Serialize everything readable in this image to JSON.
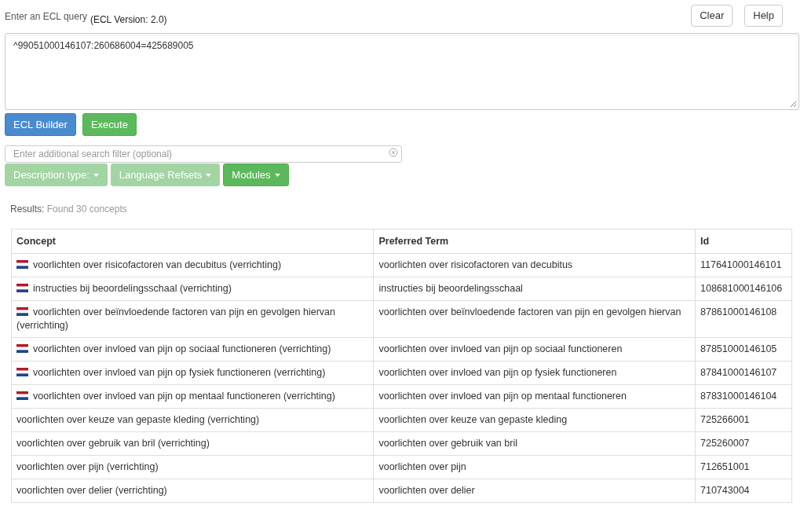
{
  "query_label": "Enter an ECL query",
  "version_label": "(ECL Version: 2.0)",
  "header_buttons": [
    "Clear",
    "Help"
  ],
  "query": {
    "value": "^99051000146107:260686004=425689005"
  },
  "action_buttons": [
    {
      "label": "ECL Builder",
      "kind": "primary"
    },
    {
      "label": "Execute",
      "kind": "success"
    }
  ],
  "filter": {
    "placeholder": "Enter additional search filter (optional)"
  },
  "dropdowns": [
    {
      "label": "Description type:",
      "disabled": true
    },
    {
      "label": "Language Refsets",
      "disabled": true
    },
    {
      "label": "Modules",
      "disabled": false
    }
  ],
  "results": {
    "label": "Results:",
    "value": "Found 30 concepts"
  },
  "table": {
    "columns": [
      "Concept",
      "Preferred Term",
      "Id"
    ],
    "rows": [
      {
        "flag": true,
        "concept": "voorlichten over risicofactoren van decubitus (verrichting)",
        "term": "voorlichten over risicofactoren van decubitus",
        "id": "117641000146101"
      },
      {
        "flag": true,
        "concept": "instructies bij beoordelingsschaal (verrichting)",
        "term": "instructies bij beoordelingsschaal",
        "id": "108681000146106"
      },
      {
        "flag": true,
        "concept": "voorlichten over beïnvloedende factoren van pijn en gevolgen hiervan (verrichting)",
        "term": "voorlichten over beïnvloedende factoren van pijn en gevolgen hiervan",
        "id": "87861000146108"
      },
      {
        "flag": true,
        "concept": "voorlichten over invloed van pijn op sociaal functioneren (verrichting)",
        "term": "voorlichten over invloed van pijn op sociaal functioneren",
        "id": "87851000146105"
      },
      {
        "flag": true,
        "concept": "voorlichten over invloed van pijn op fysiek functioneren (verrichting)",
        "term": "voorlichten over invloed van pijn op fysiek functioneren",
        "id": "87841000146107"
      },
      {
        "flag": true,
        "concept": "voorlichten over invloed van pijn op mentaal functioneren (verrichting)",
        "term": "voorlichten over invloed van pijn op mentaal functioneren",
        "id": "87831000146104"
      },
      {
        "flag": false,
        "concept": "voorlichten over keuze van gepaste kleding (verrichting)",
        "term": "voorlichten over keuze van gepaste kleding",
        "id": "725266001"
      },
      {
        "flag": false,
        "concept": "voorlichten over gebruik van bril (verrichting)",
        "term": "voorlichten over gebruik van bril",
        "id": "725260007"
      },
      {
        "flag": false,
        "concept": "voorlichten over pijn (verrichting)",
        "term": "voorlichten over pijn",
        "id": "712651001"
      },
      {
        "flag": false,
        "concept": "voorlichten over delier (verrichting)",
        "term": "voorlichten over delier",
        "id": "710743004"
      }
    ]
  }
}
